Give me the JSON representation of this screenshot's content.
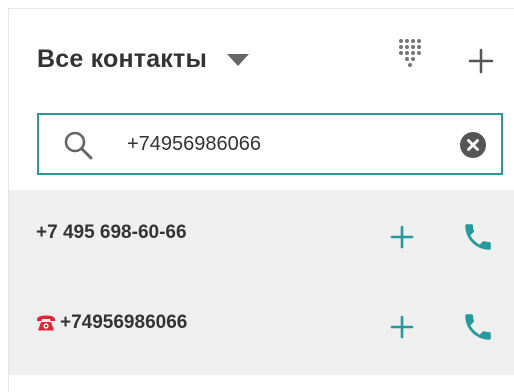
{
  "header": {
    "title": "Все контакты",
    "dialpad_icon": "dialpad-icon",
    "add_icon": "plus-icon"
  },
  "search": {
    "icon": "search-icon",
    "value": "+74956986066",
    "clear_icon": "clear-icon"
  },
  "results": [
    {
      "label": "+7 495 698-60-66",
      "has_phone_badge": false,
      "add_icon": "plus-icon",
      "call_icon": "phone-icon"
    },
    {
      "label": "+74956986066",
      "has_phone_badge": true,
      "badge_icon": "telephone-icon",
      "add_icon": "plus-icon",
      "call_icon": "phone-icon"
    }
  ],
  "colors": {
    "accent": "#26999c",
    "text": "#333333",
    "row_background": "#efefef",
    "badge": "#e0243a"
  }
}
